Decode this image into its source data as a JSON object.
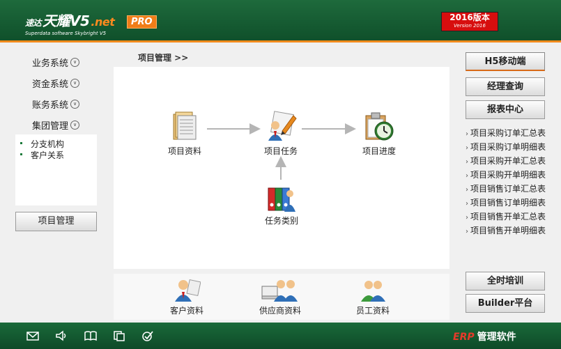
{
  "header": {
    "logo_prefix": "速达",
    "logo_name": "天耀V5",
    "logo_net": ".net",
    "logo_sub": "Superdata software Skybright V5",
    "pro_badge": "PRO",
    "version_title": "2016版本",
    "version_sub": "Version 2016"
  },
  "sidebar": {
    "menu": [
      {
        "label": "业务系统"
      },
      {
        "label": "资金系统"
      },
      {
        "label": "账务系统"
      },
      {
        "label": "集团管理"
      }
    ],
    "submenu": [
      {
        "label": "分支机构"
      },
      {
        "label": "客户关系"
      }
    ],
    "project_button": "项目管理"
  },
  "breadcrumb": "项目管理 >>",
  "workflow": {
    "nodes": [
      {
        "label": "项目资料",
        "icon": "project-docs-icon"
      },
      {
        "label": "项目任务",
        "icon": "project-task-icon"
      },
      {
        "label": "项目进度",
        "icon": "project-progress-icon"
      },
      {
        "label": "任务类别",
        "icon": "task-category-icon"
      }
    ]
  },
  "quick_links": [
    {
      "label": "客户资料",
      "icon": "customer-icon"
    },
    {
      "label": "供应商资料",
      "icon": "supplier-icon"
    },
    {
      "label": "员工资料",
      "icon": "employee-icon"
    }
  ],
  "right": {
    "mobile_button": "H5移动端",
    "manager_button": "经理查询",
    "report_button": "报表中心",
    "reports": [
      "项目采购订单汇总表",
      "项目采购订单明细表",
      "项目采购开单汇总表",
      "项目采购开单明细表",
      "项目销售订单汇总表",
      "项目销售订单明细表",
      "项目销售开单汇总表",
      "项目销售开单明细表"
    ],
    "training_button": "全时培训",
    "builder_button": "Builder平台"
  },
  "footer": {
    "erp": "ERP",
    "title": "管理软件",
    "icons": [
      "mail-icon",
      "speaker-icon",
      "book-icon",
      "copy-icon",
      "check-icon"
    ]
  },
  "colors": {
    "header_green": "#1e6a3c",
    "accent_orange": "#f08a1c",
    "version_red": "#d70e0e"
  }
}
